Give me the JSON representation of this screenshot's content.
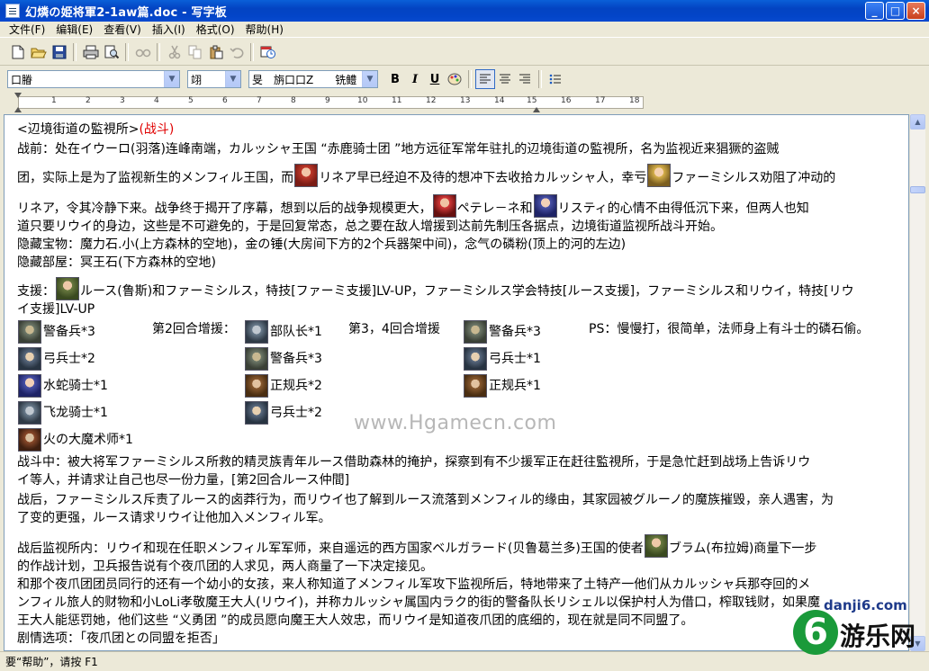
{
  "window": {
    "title": "幻燐の姫将軍2-1aw篇.doc - 写字板",
    "min_label": "_",
    "max_label": "□",
    "close_label": "×"
  },
  "menu": [
    "文件(F)",
    "编辑(E)",
    "查看(V)",
    "插入(I)",
    "格式(O)",
    "帮助(H)"
  ],
  "toolbar": {
    "icons": [
      "new-icon",
      "open-icon",
      "save-icon",
      "print-icon",
      "print-preview-icon",
      "find-icon",
      "cut-icon",
      "copy-icon",
      "paste-icon",
      "undo-icon",
      "insert-datetime-icon"
    ]
  },
  "format_bar": {
    "font_name": "口膡",
    "font_size": "翊",
    "script": "旻　旃口口Z　　铣鳢",
    "bold": "B",
    "italic": "I",
    "underline": "U"
  },
  "ruler": {
    "ticks": [
      "1",
      "2",
      "3",
      "4",
      "5",
      "6",
      "7",
      "8",
      "9",
      "10",
      "11",
      "12",
      "13",
      "14",
      "15",
      "16",
      "17",
      "18"
    ]
  },
  "document": {
    "l1_a": "<辺境街道の監視所>",
    "l1_b": "(战斗)",
    "l2": "战前：处在イウーロ(羽落)连峰南端，カルッシャ王国 “赤鹿骑士团 ”地方远征军常年驻扎的辺境街道の監視所，名为监视近来猖獗的盗贼",
    "l3_a": "团，实际上是为了监视新生的メンフィル王国，而",
    "l3_b": "リネア早已经迫不及待的想冲下去收拾カルッシャ人，幸亏",
    "l3_c": "ファーミシルス劝阻了冲动的",
    "l4_a": "リネア，令其冷静下来。战争终于揭开了序幕，想到以后的战争规模更大，",
    "l4_b": "ペテレ－ネ和",
    "l4_c": "リスティ的心情不由得低沉下来，但两人也知",
    "l5": "道只要リウイ的身边，这些是不可避免的，于是回复常态，总之要在敌人增援到达前先制压各据点，边境街道监视所战斗开始。",
    "l6": "隐藏宝物：魔力石.小(上方森林的空地)，金の锤(大房间下方的2个兵器架中间)，念气の磷粉(顶上的河的左边)",
    "l7": "隐藏部屋：冥王石(下方森林的空地)",
    "l8_a": "支援：",
    "l8_b": "ルース(鲁斯)和ファーミシルス，特技[ファーミ支援]LV-UP，ファーミシルス学会特技[ルース支援]，ファーミシルス和リウイ，特技[リウ",
    "l9": "イ支援]LV-UP",
    "units": {
      "r1c1": "警备兵*3",
      "r1label2": "第2回合增援：",
      "r1c2": "部队长*1",
      "r1label3": "第3，4回合增援",
      "r1c3": "警备兵*3",
      "r1note": "PS：慢慢打，很简单，法师身上有斗士的磷石偷。",
      "r2c1": "弓兵士*2",
      "r2c2": "警备兵*3",
      "r2c3": "弓兵士*1",
      "r3c1": "水蛇骑士*1",
      "r3c2": "正规兵*2",
      "r3c3": "正规兵*1",
      "r4c1": "飞龙骑士*1",
      "r4c2": "弓兵士*2",
      "r5c1": "火の大魔术师*1"
    },
    "l10": "战斗中：被大将军ファーミシルス所救的精灵族青年ルース借助森林的掩护，探察到有不少援军正在赶往監視所，于是急忙赶到战场上告诉リウ",
    "l11": "イ等人，并请求让自己也尽一份力量，[第2回合ルース仲間]",
    "l12": "战后，ファーミシルス斥责了ルース的卤莽行为，而リウイ也了解到ルース流落到メンフィル的缘由，其家园被グルーノ的魔族摧毁，亲人遇害，为",
    "l13": "了变的更强，ルース请求リウイ让他加入メンフィル军。",
    "l14_a": "战后监视所内：リウイ和现在任职メンフィル军军师，来自遥远的西方国家ベルガラード(贝鲁葛兰多)王国的使者",
    "l14_b": "ブラム(布拉姆)商量下一步",
    "l15": "的作战计划，卫兵报告说有个夜爪团的人求见，两人商量了一下决定接见。",
    "l16": "和那个夜爪团团员同行的还有一个幼小的女孩，来人称知道了メンフィル军攻下监视所后，特地带来了土特产一他们从カルッシャ兵那夺回的メ",
    "l17": "ンフィル旅人的财物和小LoLi孝敬魔王大人(リウイ)，并称カルッシャ属国内ラク的街的警备队长リシェル以保护村人为借口，榨取钱财，如果魔",
    "l18": "王大人能惩罚她，他们这些 “义勇团 ”的成员愿向魔王大人效忠，而リウイ是知道夜爪团的底细的，现在就是同不同盟了。",
    "l19": "剧情选项：「夜爪团との同盟を拒否」"
  },
  "watermark": "www.Hgamecn.com",
  "logo": {
    "url": "danji6.com",
    "digit": "6",
    "name": "游乐网"
  },
  "status": "要“帮助”，请按 F1"
}
